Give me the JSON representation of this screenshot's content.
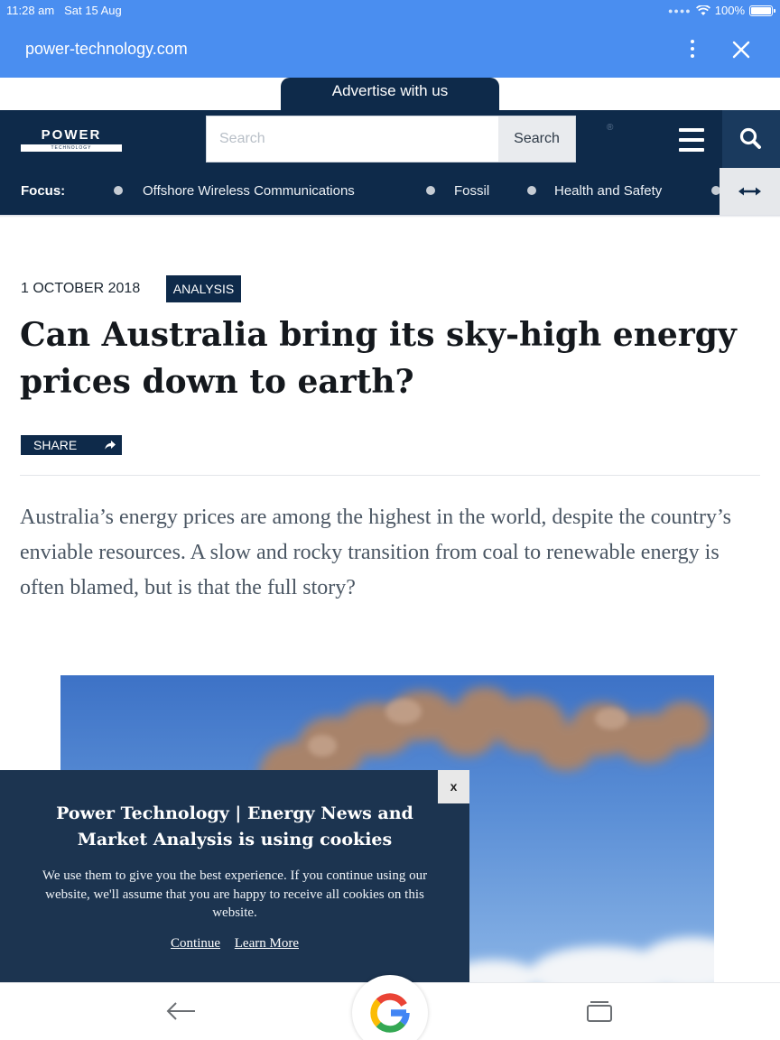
{
  "status_bar": {
    "time": "11:28 am",
    "date": "Sat 15 Aug",
    "battery": "100%"
  },
  "browser": {
    "url": "power-technology.com",
    "menu_icon": "kebab-menu-icon",
    "close_icon": "close-icon"
  },
  "advert": {
    "label": "Advertise with us"
  },
  "site": {
    "logo_word": "POWER",
    "logo_sub": "TECHNOLOGY",
    "search_placeholder": "Search",
    "search_button": "Search",
    "registered_mark": "®"
  },
  "focus": {
    "label": "Focus:",
    "items": [
      "Offshore Wireless Communications",
      "Fossil",
      "Health and Safety"
    ]
  },
  "article": {
    "date": "1 OCTOBER 2018",
    "tag": "ANALYSIS",
    "title": "Can Australia bring its sky-high energy prices down to earth?",
    "share_label": "SHARE",
    "lead": "Australia’s energy prices are among the highest in the world, despite the country’s enviable resources. A slow and rocky transition from coal to renewable energy is often blamed, but is that the full story?"
  },
  "cookie_banner": {
    "close_label": "x",
    "title": "Power Technology | Energy News and Market Analysis is using cookies",
    "body": "We use them to give you the best experience. If you continue using our website, we'll assume that you are happy to receive all cookies on this website.",
    "continue_label": "Continue",
    "learn_more_label": "Learn More"
  },
  "colors": {
    "browser_blue": "#4a8ef0",
    "site_navy": "#0e2a4a",
    "cookie_navy": "#1c3450"
  }
}
